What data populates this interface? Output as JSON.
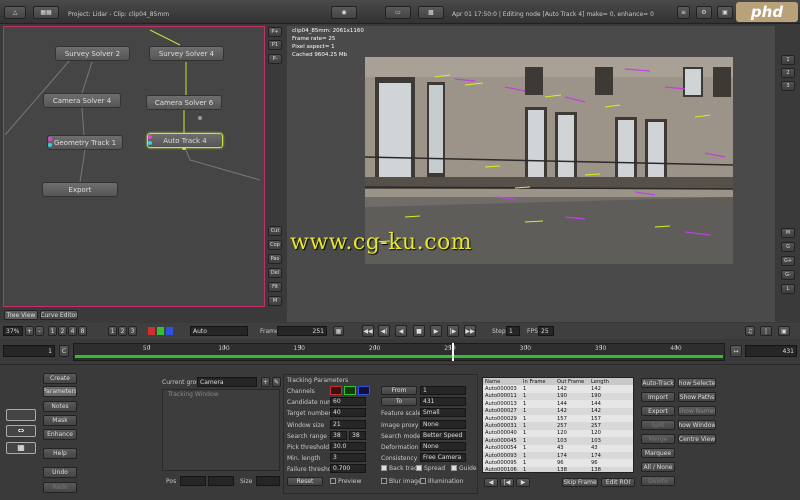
{
  "titlebar": {
    "project": "Project: Lidar - Clip: clip04_85mm",
    "status": "Apr 01 17:50:0 | Editing node [Auto Track 4] make= 0, enhance= 0",
    "logo": "phd"
  },
  "graph": {
    "nodes": [
      "Survey Solver 2",
      "Survey Solver 4",
      "Camera Solver 4",
      "Camera Solver 6",
      "Geometry Track 1",
      "Auto Track 4",
      "Export"
    ],
    "side_top": [
      "P+",
      "P1",
      "P-"
    ],
    "side_bottom": [
      "Cut",
      "Cop",
      "Pas",
      "Del",
      "Fit",
      "M"
    ],
    "tabs": [
      "Tree View",
      "Curve Editor"
    ]
  },
  "viewer": {
    "info": [
      "clip04_85mm: 2061x1160",
      "Frame rate= 25",
      "Pixel aspect= 1",
      "Cached 9604.25 Mb"
    ],
    "watermark": "www.cg-ku.com",
    "right_buttons": [
      "1",
      "2",
      "3",
      "M",
      "G",
      "G+",
      "G-",
      "L"
    ]
  },
  "transport": {
    "zoom": "37%",
    "lut": "Auto",
    "frame_label": "Frame",
    "frame": "251",
    "step_label": "Step",
    "step": "1",
    "fps_label": "FPS",
    "fps": "25",
    "timeline_start": "1",
    "timeline_end": "431",
    "ticks": [
      "50",
      "100",
      "150",
      "200",
      "250",
      "300",
      "350",
      "400"
    ]
  },
  "left_buttons": [
    "Create",
    "Parameters",
    "Notes",
    "Mask",
    "Enhance",
    "Help",
    "Undo",
    "Redo"
  ],
  "params": {
    "current_group_label": "Current group",
    "current_group": "Camera",
    "tracking_window": "Tracking Window",
    "pos_label": "Pos",
    "size_label": "Size",
    "section_title": "Tracking Parameters",
    "channels_label": "Channels",
    "candidate_label": "Candidate number",
    "candidate": "60",
    "target_label": "Target number",
    "target": "40",
    "window_label": "Window size",
    "window": "21",
    "search_range_label": "Search range",
    "search_range_a": "38",
    "search_range_b": "38",
    "pick_label": "Pick threshold %",
    "pick": "30.0",
    "min_length_label": "Min. length",
    "min_length": "3",
    "failure_label": "Failure threshold",
    "failure": "0.700",
    "from_label": "From",
    "from": "1",
    "to_label": "To",
    "to": "431",
    "feature_scale_label": "Feature scale",
    "feature_scale": "Small",
    "image_proxy_label": "Image proxy",
    "image_proxy": "None",
    "search_mode_label": "Search mode",
    "search_mode": "Better Speed",
    "deformation_label": "Deformation",
    "deformation": "None",
    "consistency_label": "Consistency",
    "consistency": "Free Camera",
    "back_track": "Back track",
    "spread": "Spread",
    "guide": "Guide",
    "reset": "Reset",
    "preview": "Preview",
    "blur_image": "Blur image",
    "illumination": "Illumination"
  },
  "track_table": {
    "headers": [
      "Name",
      "In Frame",
      "Out Frame",
      "Length"
    ],
    "rows": [
      [
        "Auto000003",
        "1",
        "142",
        "142"
      ],
      [
        "Auto000011",
        "1",
        "190",
        "190"
      ],
      [
        "Auto000013",
        "1",
        "144",
        "144"
      ],
      [
        "Auto000027",
        "1",
        "142",
        "142"
      ],
      [
        "Auto000029",
        "1",
        "157",
        "157"
      ],
      [
        "Auto000031",
        "1",
        "257",
        "257"
      ],
      [
        "Auto000040",
        "1",
        "120",
        "120"
      ],
      [
        "Auto000045",
        "1",
        "103",
        "103"
      ],
      [
        "Auto000054",
        "1",
        "43",
        "43"
      ],
      [
        "Auto000093",
        "1",
        "174",
        "174"
      ],
      [
        "Auto000095",
        "1",
        "96",
        "96"
      ],
      [
        "Auto000106",
        "1",
        "138",
        "138"
      ],
      [
        "Auto000112",
        "1",
        "171",
        "171"
      ]
    ],
    "footer": [
      "Skip Frame",
      "Edit ROI"
    ]
  },
  "right_panel": {
    "col1": [
      "Auto-Track",
      "Import",
      "Export",
      "Split",
      "Merge",
      "Marquee",
      "All / None",
      "Delete"
    ],
    "col2": [
      "Show Selected",
      "Show Paths",
      "Show Names",
      "Show Windows",
      "Centre View"
    ]
  }
}
